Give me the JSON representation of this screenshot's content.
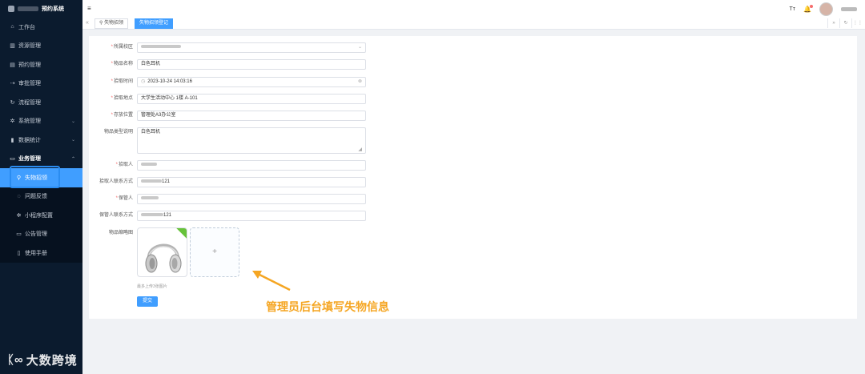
{
  "sidebar": {
    "app_title": "预约系统",
    "items": [
      {
        "label": "工作台",
        "icon": "home-icon"
      },
      {
        "label": "资源管理",
        "icon": "database-icon"
      },
      {
        "label": "预约管理",
        "icon": "document-icon"
      },
      {
        "label": "审批管理",
        "icon": "approve-icon"
      },
      {
        "label": "流程管理",
        "icon": "refresh-icon"
      },
      {
        "label": "系统管理",
        "icon": "gear-icon"
      },
      {
        "label": "数据统计",
        "icon": "chart-icon"
      },
      {
        "label": "业务管理",
        "icon": "monitor-icon"
      }
    ],
    "sub_items": [
      {
        "label": "失物招领",
        "icon": "location-icon"
      },
      {
        "label": "问题反馈",
        "icon": "chat-icon"
      },
      {
        "label": "小程序配置",
        "icon": "gear-icon"
      },
      {
        "label": "公告管理",
        "icon": "monitor-icon"
      },
      {
        "label": "使用手册",
        "icon": "book-icon"
      }
    ]
  },
  "tags": {
    "tab1": "失物招领",
    "tab2": "失物招领登记"
  },
  "form": {
    "campus": {
      "label": "所属校区"
    },
    "item_name": {
      "label": "物品名称",
      "value": "白色耳机"
    },
    "pickup_time": {
      "label": "拾取时间",
      "value": "2023-10-24 14:03:16"
    },
    "pickup_place": {
      "label": "拾取地点",
      "value": "大学生活动中心 1楼 A-101"
    },
    "storage": {
      "label": "存放位置",
      "value": "管理处A3办公室"
    },
    "desc": {
      "label": "物品类型说明",
      "value": "白色耳机"
    },
    "finder": {
      "label": "拾取人"
    },
    "finder_contact": {
      "label": "拾取人联系方式",
      "value": "121"
    },
    "keeper": {
      "label": "保管人"
    },
    "keeper_contact": {
      "label": "保管人联系方式",
      "value": "121"
    },
    "thumbnail": {
      "label": "物品缩略图",
      "add": "+"
    },
    "hint": "最多上传3张图片",
    "submit": "提交"
  },
  "annotation": "管理员后台填写失物信息",
  "watermark": "大数跨境",
  "colors": {
    "primary": "#409eff",
    "sidebar": "#0b1b2e",
    "annotation": "#f5a623"
  }
}
